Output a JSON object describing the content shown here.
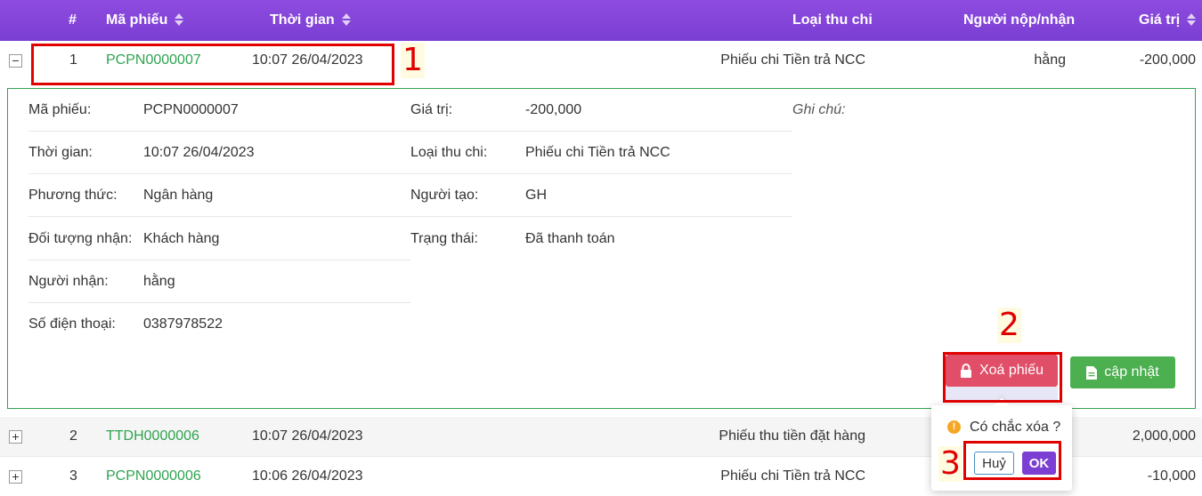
{
  "table": {
    "headers": {
      "index": "#",
      "code": "Mã phiếu",
      "time": "Thời gian",
      "type": "Loại thu chi",
      "person": "Người nộp/nhận",
      "value": "Giá trị"
    },
    "rows": [
      {
        "toggle": "−",
        "index": "1",
        "code": "PCPN0000007",
        "time": "10:07 26/04/2023",
        "type": "Phiếu chi Tiền trả NCC",
        "person": "hằng",
        "value": "-200,000"
      },
      {
        "toggle": "+",
        "index": "2",
        "code": "TTDH0000006",
        "time": "10:07 26/04/2023",
        "type": "Phiếu thu tiền đặt hàng",
        "person": "",
        "value": "2,000,000"
      },
      {
        "toggle": "+",
        "index": "3",
        "code": "PCPN0000006",
        "time": "10:06 26/04/2023",
        "type": "Phiếu chi Tiền trả NCC",
        "person": "",
        "value": "-10,000"
      }
    ]
  },
  "detail": {
    "left": [
      {
        "label": "Mã phiếu:",
        "value": "PCPN0000007"
      },
      {
        "label": "Thời gian:",
        "value": "10:07 26/04/2023"
      },
      {
        "label": "Phương thức:",
        "value": "Ngân hàng"
      },
      {
        "label": "Đối tượng nhận:",
        "value": "Khách hàng"
      },
      {
        "label": "Người nhận:",
        "value": "hằng"
      },
      {
        "label": "Số điện thoại:",
        "value": "0387978522"
      }
    ],
    "middle": [
      {
        "label": "Giá trị:",
        "value": "-200,000"
      },
      {
        "label": "Loại thu chi:",
        "value": "Phiếu chi Tiền trả NCC"
      },
      {
        "label": "Người tạo:",
        "value": "GH"
      },
      {
        "label": "Trạng thái:",
        "value": "Đã thanh toán"
      }
    ],
    "note_label": "Ghi chú:",
    "delete_button": "Xoá phiếu",
    "update_button": "cập nhật"
  },
  "confirm": {
    "message": "Có chắc xóa ?",
    "cancel": "Huỷ",
    "ok": "OK"
  },
  "annotations": [
    "1",
    "2",
    "3"
  ],
  "colors": {
    "header": "#7b3fd3",
    "code_text": "#2ea44f",
    "delete": "#e04e68",
    "update": "#4caf50",
    "annotation": "#e00000"
  }
}
